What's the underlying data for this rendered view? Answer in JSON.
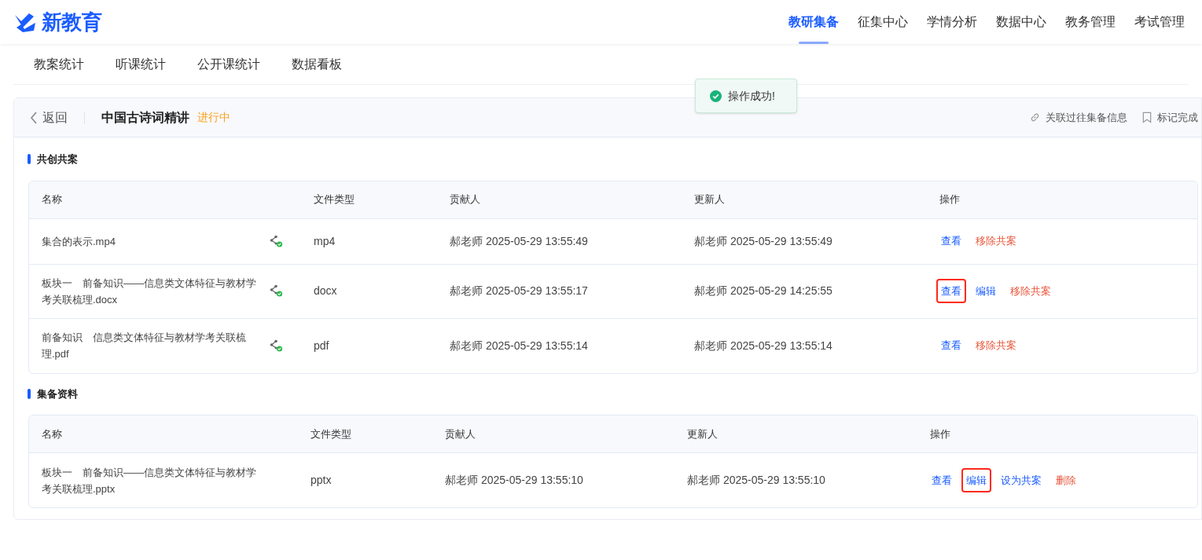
{
  "logo": {
    "text": "新教育"
  },
  "nav": [
    {
      "label": "教研集备",
      "selected": true
    },
    {
      "label": "征集中心",
      "selected": false
    },
    {
      "label": "学情分析",
      "selected": false
    },
    {
      "label": "数据中心",
      "selected": false
    },
    {
      "label": "教务管理",
      "selected": false
    },
    {
      "label": "考试管理",
      "selected": false
    }
  ],
  "subnav": [
    "教案统计",
    "听课统计",
    "公开课统计",
    "数据看板"
  ],
  "toast": {
    "message": "操作成功!"
  },
  "header": {
    "back": "返回",
    "title": "中国古诗词精讲",
    "status": "进行中",
    "actions": [
      "关联过往集备信息",
      "标记完成"
    ]
  },
  "sections": [
    {
      "title": "共创共案",
      "columns": [
        "名称",
        "文件类型",
        "贡献人",
        "更新人",
        "操作"
      ],
      "rows": [
        {
          "name": "集合的表示.mp4",
          "shared": true,
          "type": "mp4",
          "contributor": "郝老师 2025-05-29 13:55:49",
          "updater": "郝老师 2025-05-29 13:55:49",
          "actions": [
            {
              "label": "查看",
              "kind": "primary",
              "highlighted": false
            },
            {
              "label": "移除共案",
              "kind": "danger",
              "highlighted": false
            }
          ]
        },
        {
          "name": "板块一　前备知识——信息类文体特征与教材学考关联梳理.docx",
          "shared": true,
          "type": "docx",
          "contributor": "郝老师 2025-05-29 13:55:17",
          "updater": "郝老师 2025-05-29 14:25:55",
          "actions": [
            {
              "label": "查看",
              "kind": "primary",
              "highlighted": true
            },
            {
              "label": "编辑",
              "kind": "primary",
              "highlighted": false
            },
            {
              "label": "移除共案",
              "kind": "danger",
              "highlighted": false
            }
          ]
        },
        {
          "name": "前备知识　信息类文体特征与教材学考关联梳理.pdf",
          "shared": true,
          "type": "pdf",
          "contributor": "郝老师 2025-05-29 13:55:14",
          "updater": "郝老师 2025-05-29 13:55:14",
          "actions": [
            {
              "label": "查看",
              "kind": "primary",
              "highlighted": false
            },
            {
              "label": "移除共案",
              "kind": "danger",
              "highlighted": false
            }
          ]
        }
      ]
    },
    {
      "title": "集备资料",
      "columns": [
        "名称",
        "文件类型",
        "贡献人",
        "更新人",
        "操作"
      ],
      "rows": [
        {
          "name": "板块一　前备知识——信息类文体特征与教材学考关联梳理.pptx",
          "type": "pptx",
          "contributor": "郝老师 2025-05-29 13:55:10",
          "updater": "郝老师 2025-05-29 13:55:10",
          "actions": [
            {
              "label": "查看",
              "kind": "primary",
              "highlighted": false
            },
            {
              "label": "编辑",
              "kind": "primary",
              "highlighted": true
            },
            {
              "label": "设为共案",
              "kind": "primary",
              "highlighted": false
            },
            {
              "label": "删除",
              "kind": "danger",
              "highlighted": false
            }
          ]
        }
      ]
    }
  ]
}
